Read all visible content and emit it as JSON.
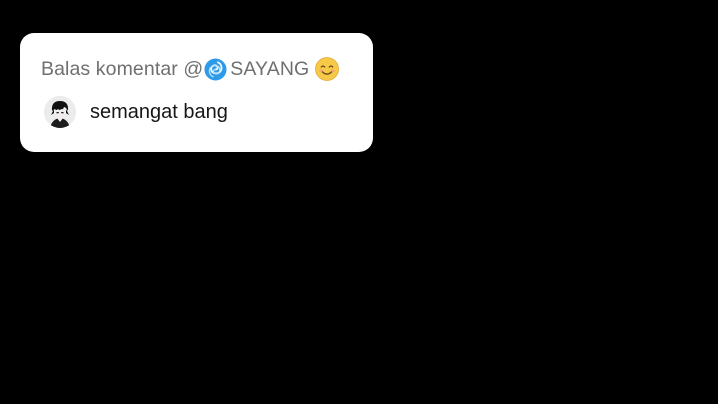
{
  "reply": {
    "prefix": "Balas komentar @",
    "mention_name": "SAYANG",
    "mention_lead_icon": "cyclone-emoji-icon",
    "mention_trail_icon": "smiling-face-emoji-icon",
    "comment_text": "semangat bang",
    "avatar_icon": "anime-character-avatar"
  },
  "colors": {
    "background": "#000000",
    "card": "#ffffff",
    "header_text": "#6f6f6f",
    "comment_text": "#161616",
    "swirl": "#2e9be8",
    "smile": "#f7c948"
  }
}
